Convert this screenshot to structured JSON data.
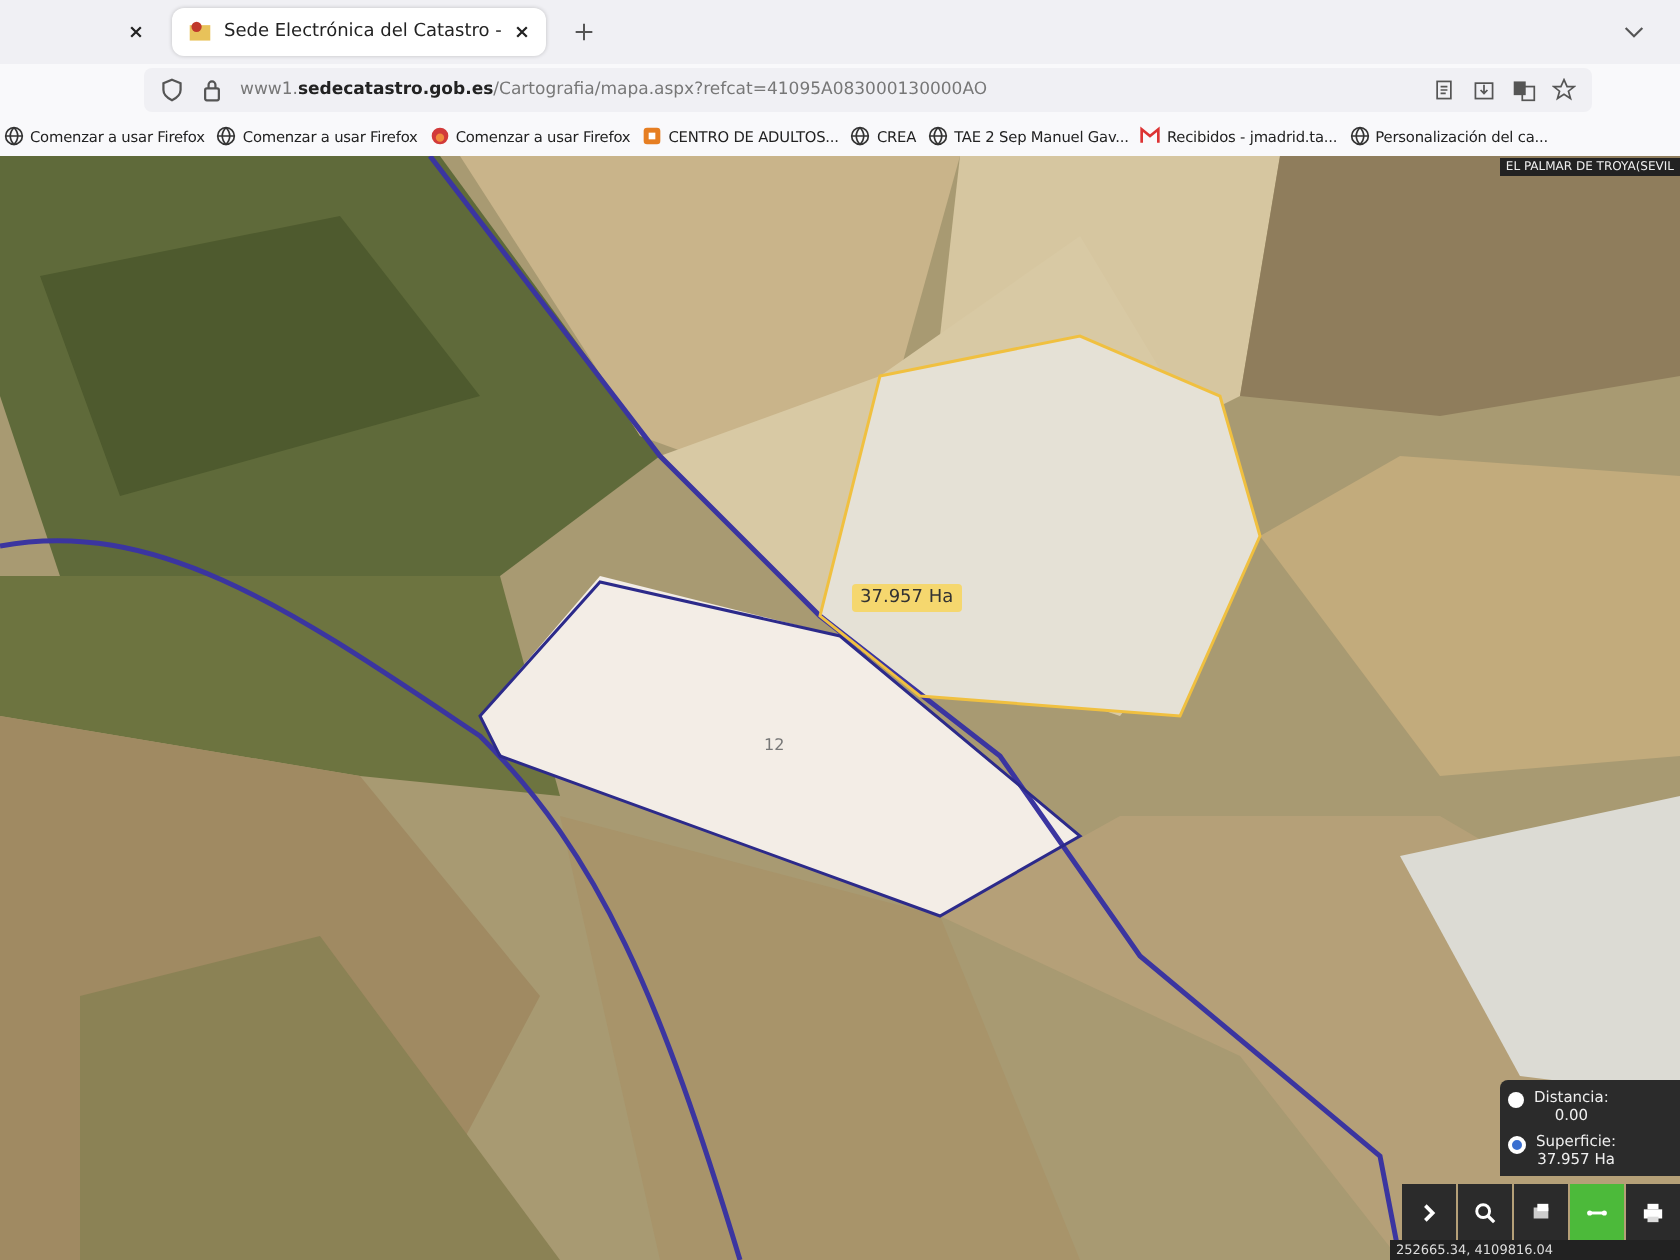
{
  "browser": {
    "tabs": [
      {
        "selected": false
      },
      {
        "title": "Sede Electrónica del Catastro - ",
        "selected": true
      }
    ],
    "url": {
      "prefix": "www1.",
      "domain": "sedecatastro.gob.es",
      "path": "/Cartografia/mapa.aspx?refcat=41095A083000130000AO"
    },
    "bookmarks": [
      {
        "label": "Comenzar a usar Firefox",
        "kind": "globe"
      },
      {
        "label": "Comenzar a usar Firefox",
        "kind": "globe"
      },
      {
        "label": "Comenzar a usar Firefox",
        "kind": "fox"
      },
      {
        "label": "CENTRO DE ADULTOS...",
        "kind": "square"
      },
      {
        "label": "CREA",
        "kind": "globe"
      },
      {
        "label": "TAE 2 Sep Manuel Gav...",
        "kind": "globe"
      },
      {
        "label": "Recibidos - jmadrid.ta...",
        "kind": "mail"
      },
      {
        "label": "Personalización del ca...",
        "kind": "globe"
      }
    ]
  },
  "map": {
    "place_label": "EL PALMAR DE TROYA(SEVIL",
    "area_label": "37.957 Ha",
    "parcel_number": "12",
    "coordinates": "252665.34, 4109816.04",
    "measure_options": [
      {
        "label": "Distancia:",
        "value": "0.00",
        "selected": false
      },
      {
        "label": "Superficie:",
        "value": "37.957 Ha",
        "selected": true
      }
    ],
    "tools": [
      {
        "kind": "chevron",
        "selected": false
      },
      {
        "kind": "search",
        "selected": false
      },
      {
        "kind": "layers",
        "selected": false
      },
      {
        "kind": "measure",
        "selected": true
      },
      {
        "kind": "print",
        "selected": false
      }
    ]
  }
}
